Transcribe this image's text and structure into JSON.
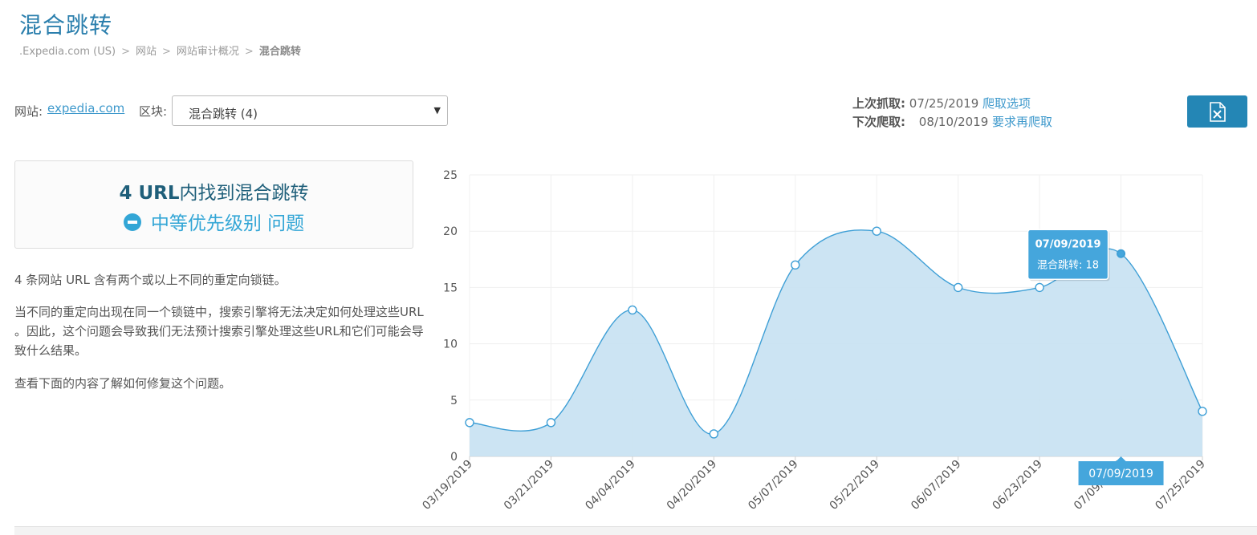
{
  "page": {
    "title": "混合跳转",
    "breadcrumb": [
      ".Expedia.com (US)",
      "网站",
      "网站审计概况",
      "混合跳转"
    ],
    "breadcrumb_sep": ">"
  },
  "filters": {
    "site_label": "网站:",
    "site_value": "expedia.com",
    "block_label": "区块:",
    "block_value": "混合跳转 (4)"
  },
  "crawl": {
    "last_label": "上次抓取:",
    "last_date": "07/25/2019",
    "last_link": "爬取选项",
    "next_label": "下次爬取:",
    "next_date": "08/10/2019",
    "next_link": "要求再爬取"
  },
  "export_button": {
    "icon": "excel-export-icon"
  },
  "summary": {
    "count": "4 URL",
    "found_text": "内找到混合跳转",
    "priority_icon": "minus-circle-icon",
    "priority_text": "中等优先级别 问题"
  },
  "description": {
    "p1": "4 条网站 URL 含有两个或以上不同的重定向锁链。",
    "p2": "当不同的重定向出现在同一个锁链中，搜索引擎将无法决定如何处理这些URL 。因此，这个问题会导致我们无法预计搜索引擎处理这些URL和它们可能会导致什么结果。",
    "p3": "查看下面的内容了解如何修复这个问题。"
  },
  "colors": {
    "accent": "#2486b5",
    "area": "#c6e1f2",
    "line": "#3e9fd6",
    "tooltip": "#45a6dc"
  },
  "chart_data": {
    "type": "area",
    "categories": [
      "03/19/2019",
      "03/21/2019",
      "04/04/2019",
      "04/20/2019",
      "05/07/2019",
      "05/22/2019",
      "06/07/2019",
      "06/23/2019",
      "07/09/2019",
      "07/25/2019"
    ],
    "series": [
      {
        "values": [
          3,
          3,
          13,
          2,
          17,
          20,
          15,
          15,
          18,
          4
        ]
      }
    ],
    "ylim": [
      0,
      25
    ],
    "yticks": [
      0,
      5,
      10,
      15,
      20,
      25
    ],
    "grid": true,
    "tooltip": {
      "date": "07/09/2019",
      "series_label": "混合跳转:",
      "value": "18"
    },
    "crosshair_label": "07/09/2019"
  }
}
